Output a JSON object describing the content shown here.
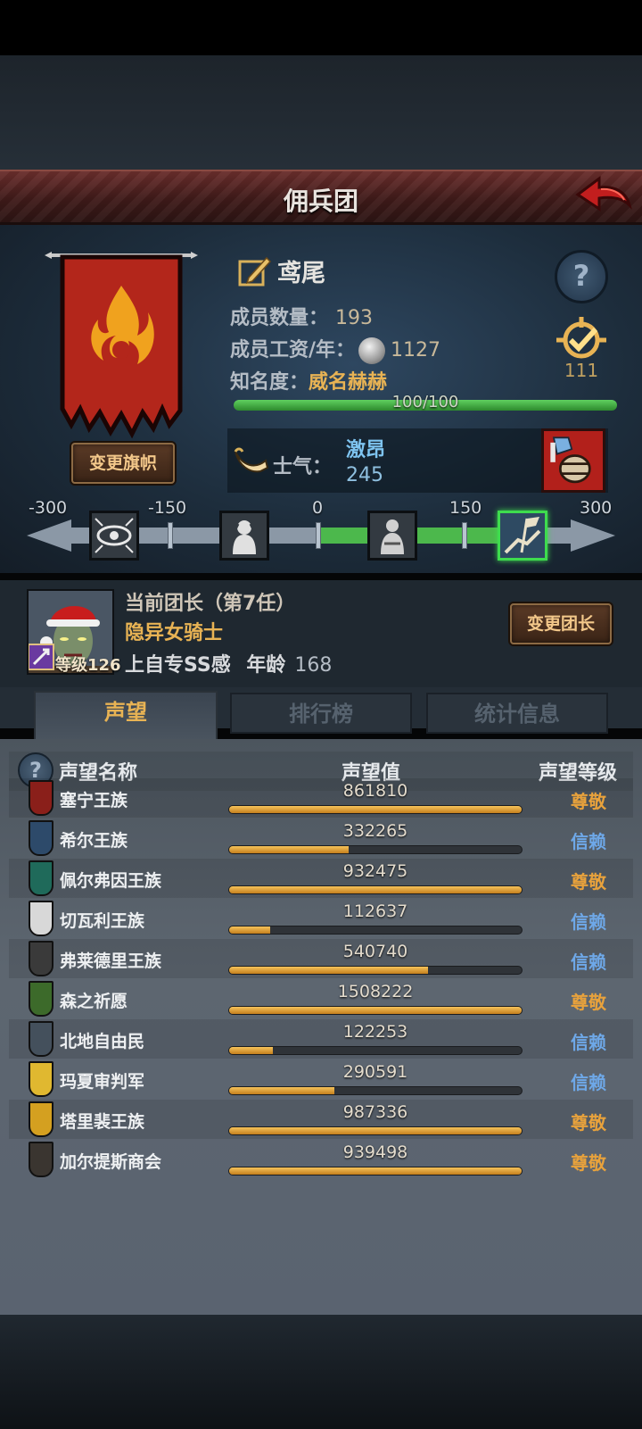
{
  "header": {
    "title": "佣兵团"
  },
  "guild": {
    "name": "鸢尾",
    "change_banner_label": "变更旗帜",
    "member_count_label": "成员数量：",
    "member_count": "193",
    "salary_label": "成员工资/年：",
    "salary": "1127",
    "fame_label": "知名度：",
    "fame_value": "威名赫赫",
    "fame_progress_text": "100/100",
    "fame_progress": 1.0,
    "target_count": "111",
    "help_symbol": "?"
  },
  "morale": {
    "label": "士气：",
    "state": "激昂",
    "value": "245",
    "scale_ticks": [
      "-300",
      "-150",
      "0",
      "150",
      "300"
    ],
    "scale_value": 245,
    "scale_range": [
      -300,
      300
    ]
  },
  "leader": {
    "title": "当前团长（第7任）",
    "name": "隐异女骑士",
    "level_label": "等级126",
    "trait": "上自专SS感",
    "age_label": "年龄",
    "age": "168",
    "change_label": "变更团长"
  },
  "tabs": [
    {
      "label": "声望",
      "active": true
    },
    {
      "label": "排行榜",
      "active": false
    },
    {
      "label": "统计信息",
      "active": false
    }
  ],
  "reputation": {
    "columns": {
      "name": "声望名称",
      "value": "声望值",
      "level": "声望等级"
    },
    "help_symbol": "?",
    "rows": [
      {
        "name": "塞宁王族",
        "value": "861810",
        "progress": 1.0,
        "level": "尊敬",
        "level_color": "#e8a23c",
        "emblem_color": "#8a1f1a"
      },
      {
        "name": "希尔王族",
        "value": "332265",
        "progress": 0.41,
        "level": "信赖",
        "level_color": "#6ea8e8",
        "emblem_color": "#2d4a6a"
      },
      {
        "name": "佩尔弗因王族",
        "value": "932475",
        "progress": 1.0,
        "level": "尊敬",
        "level_color": "#e8a23c",
        "emblem_color": "#1f6a5a"
      },
      {
        "name": "切瓦利王族",
        "value": "112637",
        "progress": 0.14,
        "level": "信赖",
        "level_color": "#6ea8e8",
        "emblem_color": "#d8d8d8"
      },
      {
        "name": "弗莱德里王族",
        "value": "540740",
        "progress": 0.68,
        "level": "信赖",
        "level_color": "#6ea8e8",
        "emblem_color": "#3a3a3a"
      },
      {
        "name": "森之祈愿",
        "value": "1508222",
        "progress": 1.0,
        "level": "尊敬",
        "level_color": "#e8a23c",
        "emblem_color": "#3c6a2a"
      },
      {
        "name": "北地自由民",
        "value": "122253",
        "progress": 0.15,
        "level": "信赖",
        "level_color": "#6ea8e8",
        "emblem_color": "#44505c"
      },
      {
        "name": "玛夏审判军",
        "value": "290591",
        "progress": 0.36,
        "level": "信赖",
        "level_color": "#6ea8e8",
        "emblem_color": "#e0b830"
      },
      {
        "name": "塔里裴王族",
        "value": "987336",
        "progress": 1.0,
        "level": "尊敬",
        "level_color": "#e8a23c",
        "emblem_color": "#d4a020"
      },
      {
        "name": "加尔提斯商会",
        "value": "939498",
        "progress": 1.0,
        "level": "尊敬",
        "level_color": "#e8a23c",
        "emblem_color": "#3a3530"
      }
    ]
  }
}
